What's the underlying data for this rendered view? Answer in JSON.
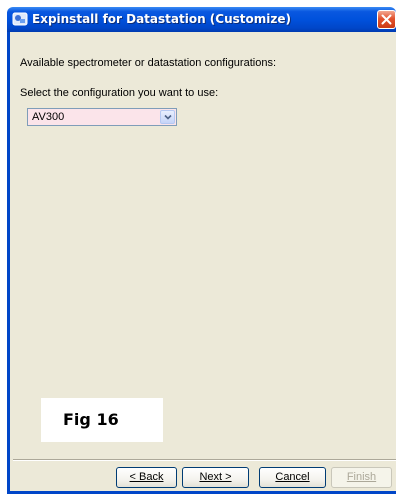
{
  "window": {
    "title": "Expinstall for Datastation (Customize)"
  },
  "content": {
    "available_label": "Available spectrometer or datastation configurations:",
    "select_label": "Select the configuration you want to use:",
    "config_select": {
      "value": "AV300"
    }
  },
  "figure_label": "Fig 16",
  "buttons": {
    "back": "< Back",
    "next": "Next >",
    "cancel": "Cancel",
    "finish": "Finish"
  },
  "colors": {
    "titlebar": "#0051dc",
    "dialog_bg": "#ece9d8",
    "combo_bg": "#fbe4ea",
    "close_button": "#e2532f"
  },
  "icons": {
    "title_icon": "app-icon",
    "close_icon": "close-icon",
    "dropdown_icon": "chevron-down-icon"
  }
}
